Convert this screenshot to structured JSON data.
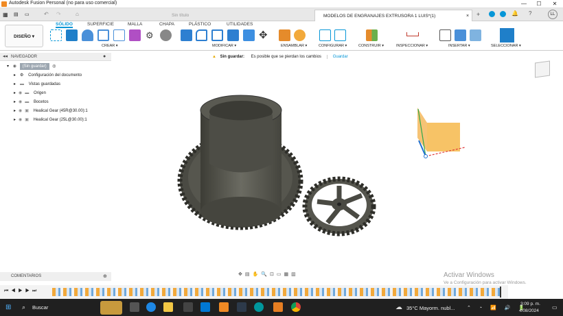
{
  "window": {
    "title": "Autodesk Fusion Personal (no para uso comercial)",
    "controls": [
      "—",
      "☐",
      "✕"
    ]
  },
  "tabs": [
    {
      "label": "Sin título"
    },
    {
      "label": "MODELOS DE ENGRANAJES EXTRUSORA 1 LUIS*(1)"
    }
  ],
  "user": {
    "initials": "LL"
  },
  "ribbon": {
    "workspace": "DISEÑO ▾",
    "tabs": [
      "SÓLIDO",
      "SUPERFICIE",
      "MALLA",
      "CHAPA",
      "PLÁSTICO",
      "UTILIDADES"
    ],
    "groups": [
      "CREAR ▾",
      "MODIFICAR ▾",
      "ENSAMBLAR ▾",
      "CONFIGURAR ▾",
      "CONSTRUIR ▾",
      "INSPECCIONAR ▾",
      "INSERTAR ▾",
      "SELECCIONAR ▾"
    ]
  },
  "navigator": {
    "title": "NAVEGADOR",
    "root": "(Sin guardar)",
    "items": [
      "Configuración del documento",
      "Vistas guardadas",
      "Origen",
      "Bocetos",
      "Healical Gear (45R@30.00):1",
      "Healical Gear (25L@30.00):1"
    ]
  },
  "warning": {
    "label": "Sin guardar:",
    "message": "Es posible que se pierdan los cambios",
    "action": "Guardar"
  },
  "comments": {
    "title": "COMENTARIOS"
  },
  "watermark": {
    "line1": "Activar Windows",
    "line2": "Ve a Configuración para activar Windows."
  },
  "taskbar": {
    "search": "Buscar",
    "weather": "35°C  Mayorm. nubl...",
    "time": "3:09 p. m.",
    "date": "4/08/2024"
  },
  "colors": {
    "accent": "#0696d7",
    "gear": "#5a5a52",
    "taskbar": "#202020"
  }
}
